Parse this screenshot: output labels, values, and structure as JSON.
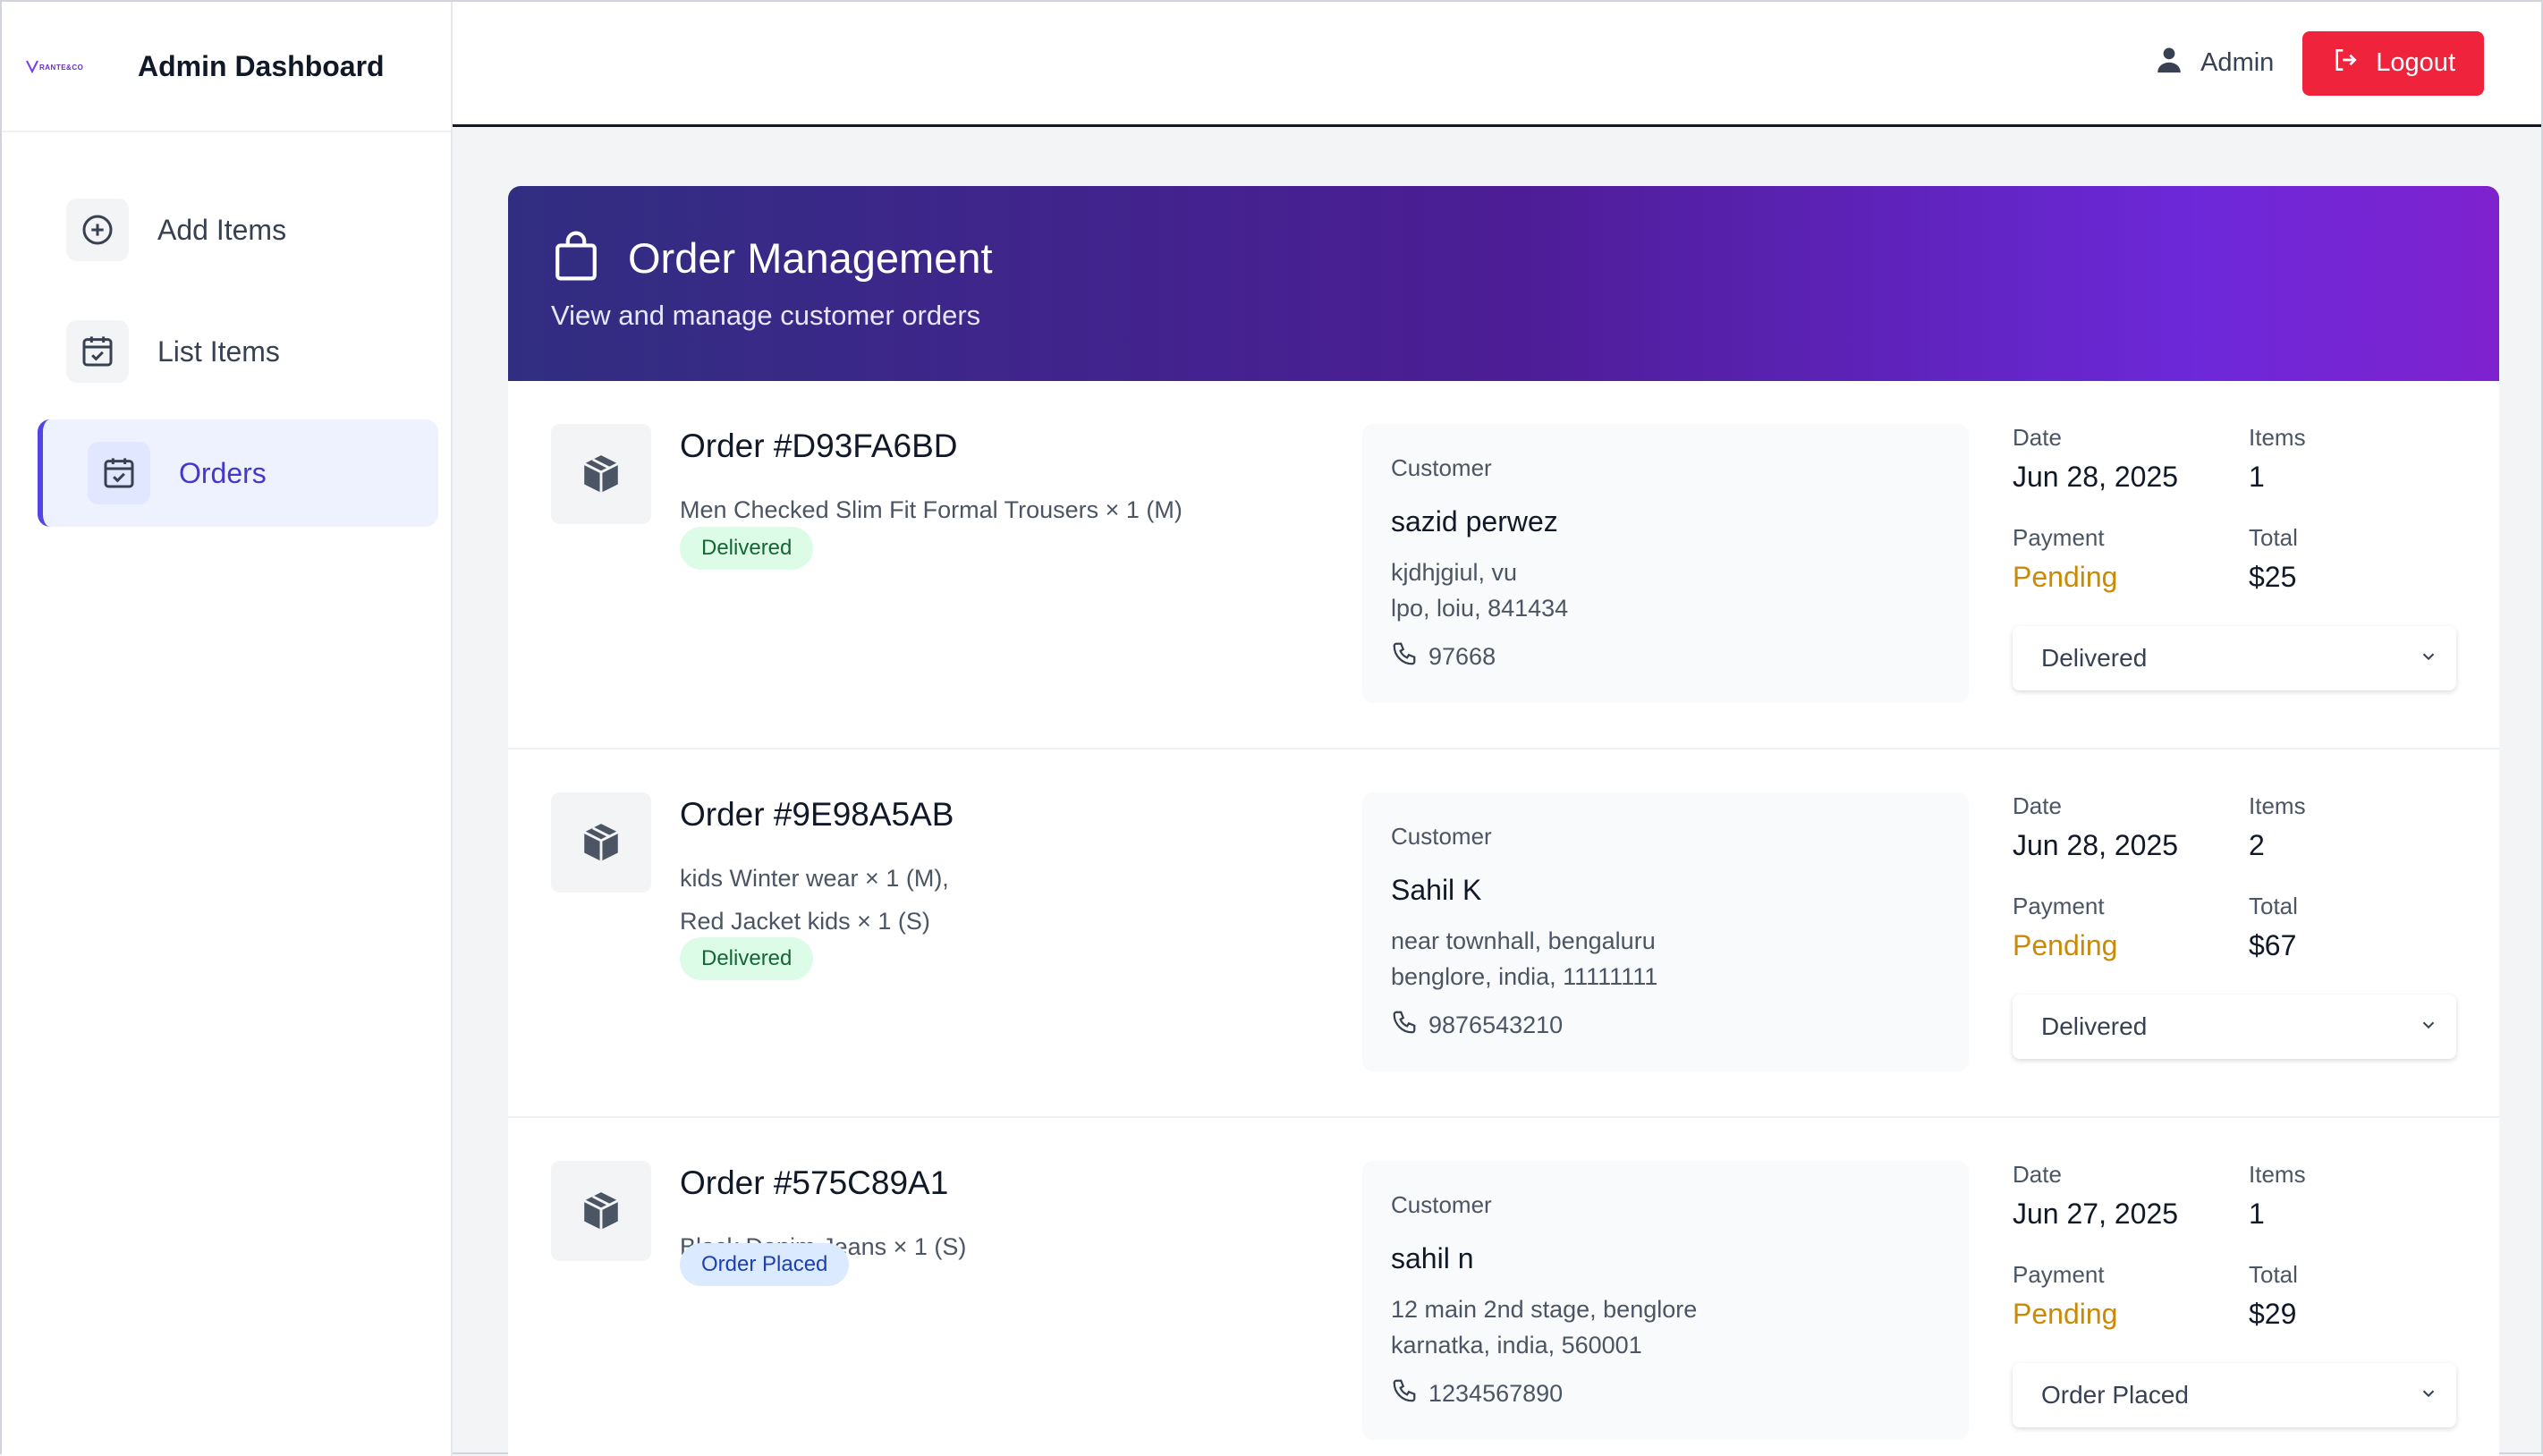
{
  "brand": {
    "logo_text": "RANTE & CO",
    "title": "Admin Dashboard"
  },
  "sidebar": {
    "items": [
      {
        "label": "Add Items",
        "icon": "plus-circle-icon",
        "active": false
      },
      {
        "label": "List Items",
        "icon": "calendar-check-icon",
        "active": false
      },
      {
        "label": "Orders",
        "icon": "calendar-check-icon",
        "active": true
      }
    ]
  },
  "topbar": {
    "user_label": "Admin",
    "logout_label": "Logout"
  },
  "colors": {
    "accent": "#4f46e5",
    "logout": "#ef233c",
    "pending": "#ca8a04",
    "banner_start": "#312e81",
    "banner_end": "#7e22ce"
  },
  "banner": {
    "title": "Order Management",
    "subtitle": "View and manage customer orders",
    "icon": "shopping-bag-icon"
  },
  "labels": {
    "customer": "Customer",
    "date": "Date",
    "items": "Items",
    "payment": "Payment",
    "total": "Total"
  },
  "orders": [
    {
      "id": "Order #D93FA6BD",
      "items": [
        "Men Checked Slim Fit Formal Trousers × 1 (M)"
      ],
      "status": "Delivered",
      "customer": {
        "name": "sazid perwez",
        "address1": "kjdhjgiul, vu",
        "address2": "lpo, loiu, 841434",
        "phone": "97668"
      },
      "date": "Jun 28, 2025",
      "item_count": "1",
      "payment": "Pending",
      "total": "$25",
      "select_value": "Delivered"
    },
    {
      "id": "Order #9E98A5AB",
      "items": [
        "kids Winter wear × 1 (M),",
        "Red Jacket kids × 1 (S)"
      ],
      "status": "Delivered",
      "customer": {
        "name": "Sahil K",
        "address1": "near townhall, bengaluru",
        "address2": "benglore, india, 11111111",
        "phone": "9876543210"
      },
      "date": "Jun 28, 2025",
      "item_count": "2",
      "payment": "Pending",
      "total": "$67",
      "select_value": "Delivered"
    },
    {
      "id": "Order #575C89A1",
      "items": [
        "Black Denim Jeans × 1 (S)"
      ],
      "status": "Order Placed",
      "customer": {
        "name": "sahil n",
        "address1": "12 main 2nd stage, benglore",
        "address2": "karnatka, india, 560001",
        "phone": "1234567890"
      },
      "date": "Jun 27, 2025",
      "item_count": "1",
      "payment": "Pending",
      "total": "$29",
      "select_value": "Order Placed"
    }
  ]
}
